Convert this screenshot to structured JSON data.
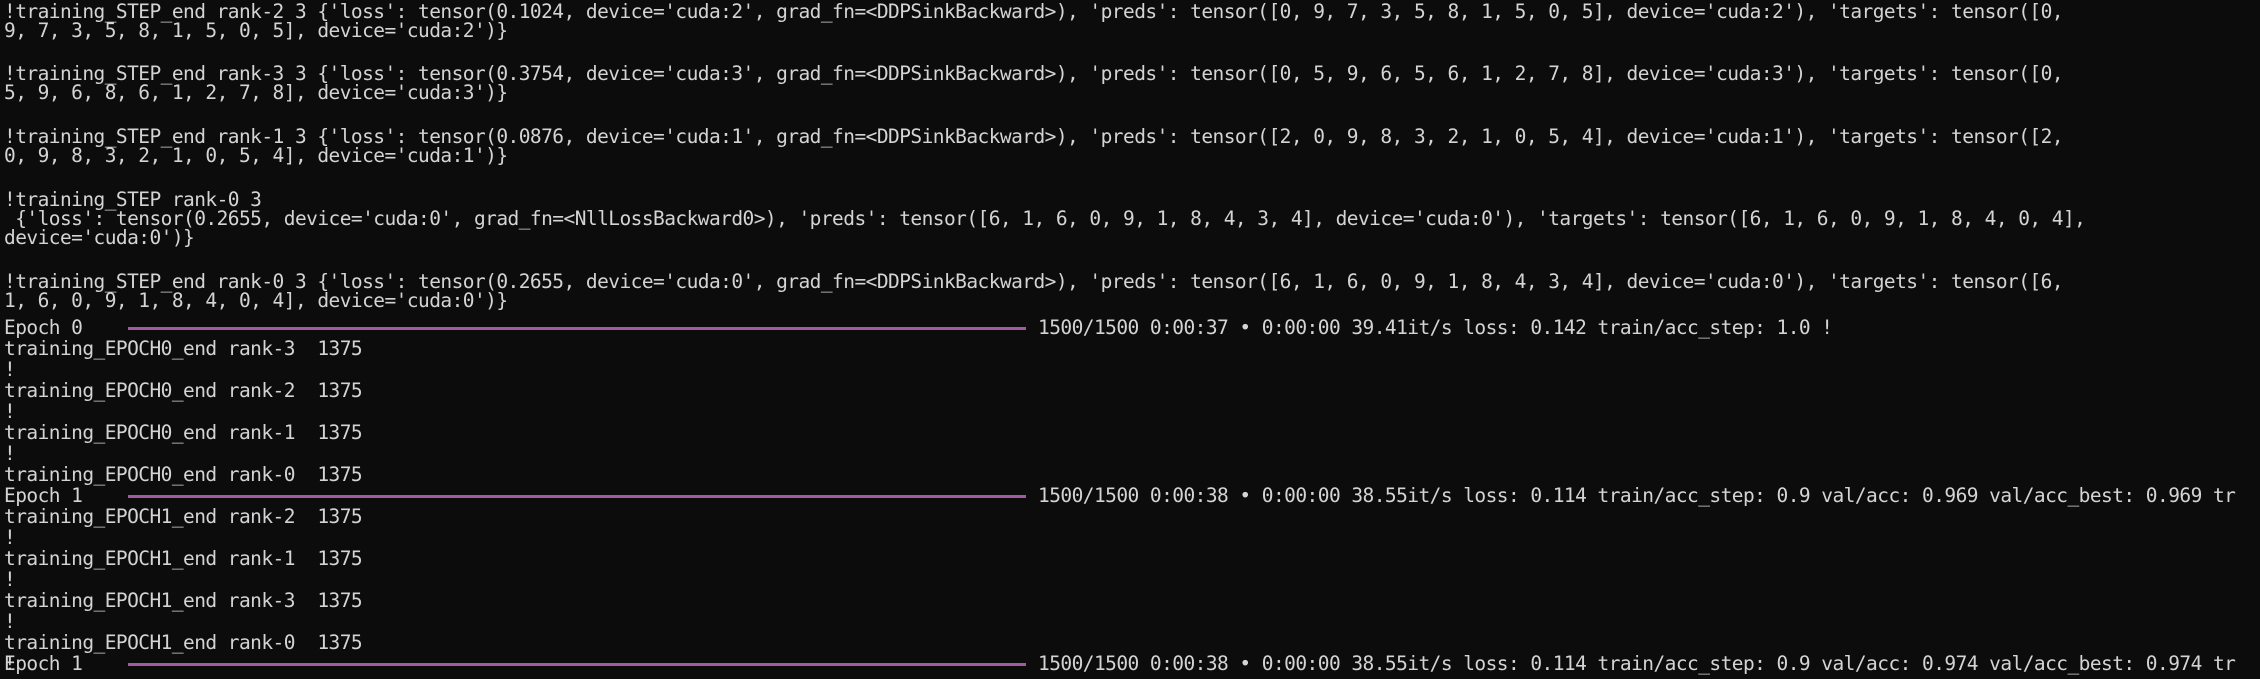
{
  "terminal": {
    "lines": [
      "!training_STEP_end rank-2 3 {'loss': tensor(0.1024, device='cuda:2', grad_fn=<DDPSinkBackward>), 'preds': tensor([0, 9, 7, 3, 5, 8, 1, 5, 0, 5], device='cuda:2'), 'targets': tensor([0,",
      "9, 7, 3, 5, 8, 1, 5, 0, 5], device='cuda:2')}",
      "!training_STEP_end rank-3 3 {'loss': tensor(0.3754, device='cuda:3', grad_fn=<DDPSinkBackward>), 'preds': tensor([0, 5, 9, 6, 5, 6, 1, 2, 7, 8], device='cuda:3'), 'targets': tensor([0,",
      "5, 9, 6, 8, 6, 1, 2, 7, 8], device='cuda:3')}",
      "!training_STEP_end rank-1 3 {'loss': tensor(0.0876, device='cuda:1', grad_fn=<DDPSinkBackward>), 'preds': tensor([2, 0, 9, 8, 3, 2, 1, 0, 5, 4], device='cuda:1'), 'targets': tensor([2,",
      "0, 9, 8, 3, 2, 1, 0, 5, 4], device='cuda:1')}",
      "!training_STEP rank-0 3",
      " {'loss': tensor(0.2655, device='cuda:0', grad_fn=<NllLossBackward0>), 'preds': tensor([6, 1, 6, 0, 9, 1, 8, 4, 3, 4], device='cuda:0'), 'targets': tensor([6, 1, 6, 0, 9, 1, 8, 4, 0, 4],",
      "device='cuda:0')}",
      "!training_STEP_end rank-0 3 {'loss': tensor(0.2655, device='cuda:0', grad_fn=<DDPSinkBackward>), 'preds': tensor([6, 1, 6, 0, 9, 1, 8, 4, 3, 4], device='cuda:0'), 'targets': tensor([6,",
      "1, 6, 0, 9, 1, 8, 4, 0, 4], device='cuda:0')}",
      "training_EPOCH0_end rank-3  1375",
      "!",
      "training_EPOCH0_end rank-2  1375",
      "!",
      "training_EPOCH0_end rank-1  1375",
      "!",
      "training_EPOCH0_end rank-0  1375",
      "training_EPOCH1_end rank-2  1375",
      "!",
      "training_EPOCH1_end rank-1  1375",
      "!",
      "training_EPOCH1_end rank-3  1375",
      "!",
      "training_EPOCH1_end rank-0  1375",
      "!"
    ],
    "progress": [
      {
        "label": "Epoch 0",
        "completed": 1500,
        "total": 1500,
        "stats": "1500/1500 0:00:37 • 0:00:00 39.41it/s loss: 0.142 train/acc_step: 1.0 !"
      },
      {
        "label": "Epoch 1",
        "completed": 1500,
        "total": 1500,
        "stats": "1500/1500 0:00:38 • 0:00:00 38.55it/s loss: 0.114 train/acc_step: 0.9 val/acc: 0.969 val/acc_best: 0.969 tr"
      },
      {
        "label": "Epoch 1",
        "completed": 1500,
        "total": 1500,
        "stats": "1500/1500 0:00:38 • 0:00:00 38.55it/s loss: 0.114 train/acc_step: 0.9 val/acc: 0.974 val/acc_best: 0.974 tr"
      }
    ],
    "colors": {
      "background": "#0c0c0c",
      "text": "#d4d4d4",
      "progress_bar": "#a35aa0"
    }
  }
}
